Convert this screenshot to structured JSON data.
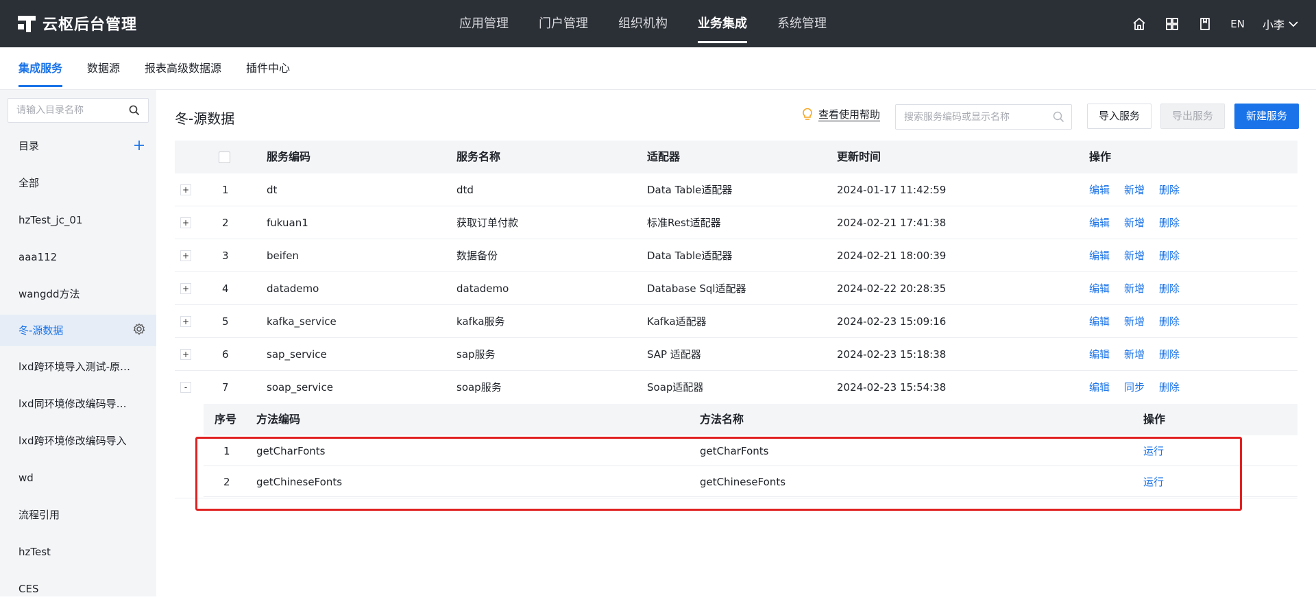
{
  "app": {
    "title": "云枢后台管理"
  },
  "nav": {
    "items": [
      {
        "label": "应用管理",
        "active": false
      },
      {
        "label": "门户管理",
        "active": false
      },
      {
        "label": "组织机构",
        "active": false
      },
      {
        "label": "业务集成",
        "active": true
      },
      {
        "label": "系统管理",
        "active": false
      }
    ]
  },
  "toolbar": {
    "home_icon": "home-icon",
    "apps_icon": "grid-icon",
    "docs_icon": "book-icon",
    "lang": "EN",
    "user": "小李"
  },
  "subtabs": [
    {
      "label": "集成服务",
      "active": true
    },
    {
      "label": "数据源",
      "active": false
    },
    {
      "label": "报表高级数据源",
      "active": false
    },
    {
      "label": "插件中心",
      "active": false
    }
  ],
  "sidebar": {
    "search_placeholder": "请输入目录名称",
    "catalog_label": "目录",
    "items": [
      {
        "label": "全部"
      },
      {
        "label": "hzTest_jc_01"
      },
      {
        "label": "aaa112"
      },
      {
        "label": "wangdd方法"
      },
      {
        "label": "冬-源数据",
        "active": true
      },
      {
        "label": "lxd跨环境导入测试-原数据"
      },
      {
        "label": "lxd同环境修改编码导入测试"
      },
      {
        "label": "lxd跨环境修改编码导入"
      },
      {
        "label": "wd"
      },
      {
        "label": "流程引用"
      },
      {
        "label": "hzTest"
      },
      {
        "label": "CES"
      }
    ]
  },
  "content": {
    "title": "冬-源数据",
    "help": "查看使用帮助",
    "search_placeholder": "搜索服务编码或显示名称",
    "import_btn": "导入服务",
    "export_btn": "导出服务",
    "new_btn": "新建服务"
  },
  "table": {
    "headers": {
      "code": "服务编码",
      "name": "服务名称",
      "adapter": "适配器",
      "updated": "更新时间",
      "ops": "操作"
    },
    "rows": [
      {
        "expand": "+",
        "no": "1",
        "code": "dt",
        "name": "dtd",
        "adapter": "Data Table适配器",
        "updated": "2024-01-17 11:42:59",
        "op1": "编辑",
        "op2": "新增",
        "op3": "删除"
      },
      {
        "expand": "+",
        "no": "2",
        "code": "fukuan1",
        "name": "获取订单付款",
        "adapter": "标准Rest适配器",
        "updated": "2024-02-21 17:41:38",
        "op1": "编辑",
        "op2": "新增",
        "op3": "删除"
      },
      {
        "expand": "+",
        "no": "3",
        "code": "beifen",
        "name": "数据备份",
        "adapter": "Data Table适配器",
        "updated": "2024-02-21 18:00:39",
        "op1": "编辑",
        "op2": "新增",
        "op3": "删除"
      },
      {
        "expand": "+",
        "no": "4",
        "code": "datademo",
        "name": "datademo",
        "adapter": "Database Sql适配器",
        "updated": "2024-02-22 20:28:35",
        "op1": "编辑",
        "op2": "新增",
        "op3": "删除"
      },
      {
        "expand": "+",
        "no": "5",
        "code": "kafka_service",
        "name": "kafka服务",
        "adapter": "Kafka适配器",
        "updated": "2024-02-23 15:09:16",
        "op1": "编辑",
        "op2": "新增",
        "op3": "删除"
      },
      {
        "expand": "+",
        "no": "6",
        "code": "sap_service",
        "name": "sap服务",
        "adapter": "SAP 适配器",
        "updated": "2024-02-23 15:18:38",
        "op1": "编辑",
        "op2": "新增",
        "op3": "删除"
      },
      {
        "expand": "-",
        "no": "7",
        "code": "soap_service",
        "name": "soap服务",
        "adapter": "Soap适配器",
        "updated": "2024-02-23 15:54:38",
        "op1": "编辑",
        "op2": "同步",
        "op3": "删除"
      }
    ],
    "methods": {
      "headers": {
        "no": "序号",
        "code": "方法编码",
        "name": "方法名称",
        "ops": "操作"
      },
      "rows": [
        {
          "no": "1",
          "code": "getCharFonts",
          "name": "getCharFonts",
          "op": "运行"
        },
        {
          "no": "2",
          "code": "getChineseFonts",
          "name": "getChineseFonts",
          "op": "运行"
        }
      ]
    }
  },
  "colors": {
    "accent": "#1a73e8",
    "topbar": "#2b2f36",
    "highlight": "#e02020"
  }
}
